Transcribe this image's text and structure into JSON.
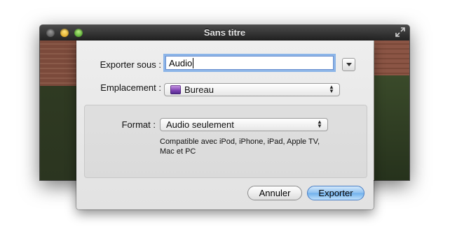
{
  "window": {
    "title": "Sans titre"
  },
  "dialog": {
    "export_label": "Exporter sous :",
    "export_value": "Audio",
    "location_label": "Emplacement :",
    "location_value": "Bureau",
    "format_label": "Format :",
    "format_value": "Audio seulement",
    "compat_text": "Compatible avec iPod, iPhone, iPad, Apple TV, Mac et PC",
    "cancel_label": "Annuler",
    "export_button_label": "Exporter"
  },
  "colors": {
    "default_button": "#6fb0ec",
    "focus_ring": "#6ba1e6"
  }
}
